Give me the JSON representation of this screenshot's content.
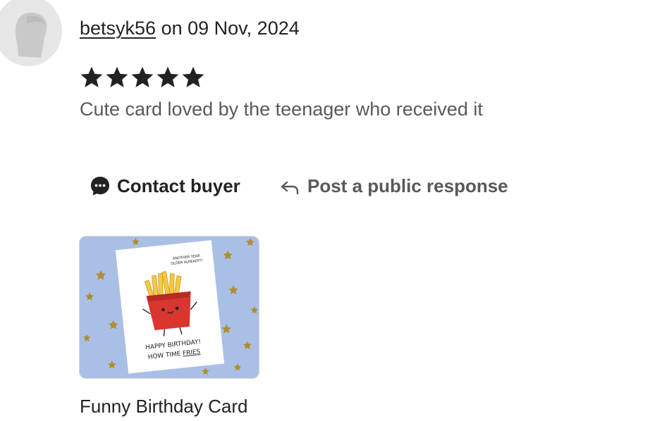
{
  "review": {
    "username": "betsyk56",
    "date_text": "on 09 Nov, 2024",
    "rating": 5,
    "rating_max": 5,
    "text": "Cute card loved by the teenager who received it"
  },
  "actions": {
    "contact_label": "Contact buyer",
    "public_response_label": "Post a public response"
  },
  "product": {
    "title": "Funny Birthday Card",
    "card_text": {
      "top_line1": "ANOTHER YEAR",
      "top_line2": "OLDER ALREADY?!",
      "bottom_line1": "HAPPY BIRTHDAY!",
      "bottom_line2_prefix": "HOW TIME ",
      "bottom_line2_highlight": "FRIES"
    }
  },
  "colors": {
    "text_primary": "#222222",
    "text_secondary": "#595959",
    "star": "#222222",
    "thumb_background": "#a9bfe6",
    "fries_box": "#d8362f",
    "fries": "#f5c842"
  },
  "icons": {
    "avatar": "person-silhouette-icon",
    "contact": "chat-bubble-icon",
    "post_response": "reply-arrow-icon",
    "star": "star-icon"
  }
}
